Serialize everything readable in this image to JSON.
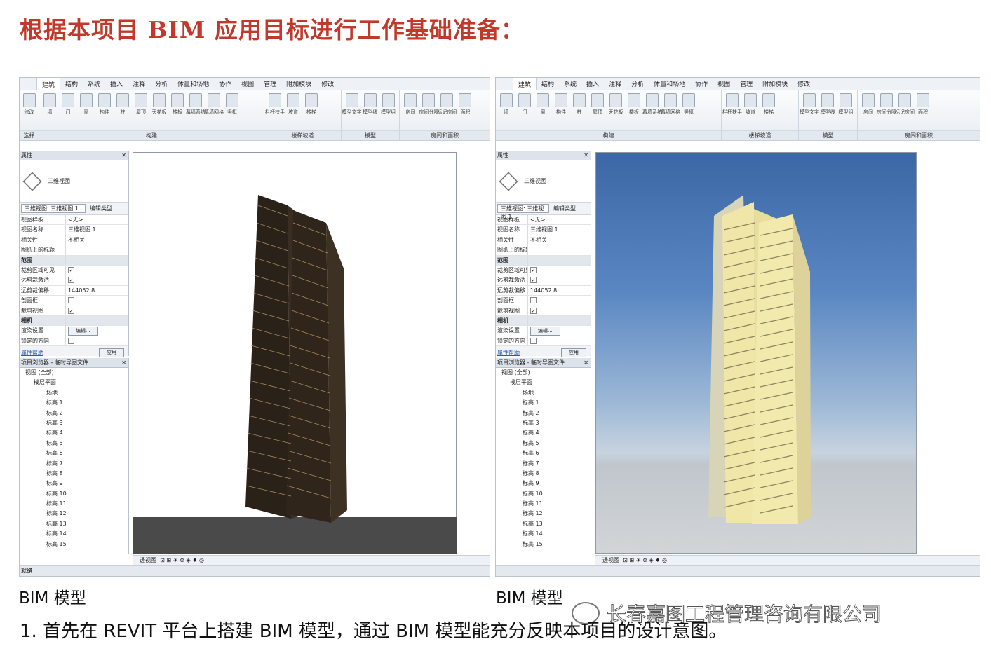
{
  "slide_title": "根据本项目 BIM 应用目标进行工作基础准备：",
  "ribbon": {
    "tabs": [
      "建筑",
      "结构",
      "系统",
      "插入",
      "注释",
      "分析",
      "体量和场地",
      "协作",
      "视图",
      "管理",
      "附加模块",
      "修改"
    ],
    "groups": [
      {
        "label": "构建",
        "buttons": [
          "墙",
          "门",
          "窗",
          "构件",
          "柱",
          "屋顶",
          "天花板",
          "楼板",
          "幕墙系统",
          "幕墙网格",
          "竖梃"
        ]
      },
      {
        "label": "楼梯坡道",
        "buttons": [
          "栏杆扶手",
          "坡道",
          "楼梯"
        ]
      },
      {
        "label": "模型",
        "buttons": [
          "模型文字",
          "模型线",
          "模型组"
        ]
      },
      {
        "label": "房间和面积",
        "buttons": [
          "房间",
          "房间分隔",
          "标记房间",
          "面积"
        ]
      }
    ],
    "modify_label": "修改",
    "select_label": "选择"
  },
  "properties": {
    "header": "属性",
    "type_name": "三维视图",
    "selector": "三维视图: 三维视图 1",
    "edit_type": "编辑类型",
    "rows": [
      {
        "key": "视图样板",
        "value": "<无>"
      },
      {
        "key": "视图名称",
        "value": "三维视图 1"
      },
      {
        "key": "相关性",
        "value": "不相关"
      },
      {
        "key": "图纸上的标题",
        "value": ""
      }
    ],
    "section_extents": "范围",
    "extent_rows": [
      {
        "key": "裁剪区域可见",
        "checked": true
      },
      {
        "key": "远剪裁激活",
        "checked": true
      },
      {
        "key": "远剪裁偏移",
        "value": "144052.8"
      },
      {
        "key": "剖面框",
        "checked": false
      },
      {
        "key": "裁剪视图",
        "checked": true
      }
    ],
    "section_camera": "相机",
    "render_settings": "渲染设置",
    "edit_button": "编辑...",
    "locked_orientation": "锁定的方向",
    "help_link": "属性帮助",
    "apply_button": "应用"
  },
  "browser": {
    "header": "项目浏览器 - 临时导图文件",
    "root": "视图 (全部)",
    "floor_plans": "楼层平面",
    "items": [
      "场地",
      "标高 1",
      "标高 2",
      "标高 3",
      "标高 4",
      "标高 5",
      "标高 6",
      "标高 7",
      "标高 8",
      "标高 9",
      "标高 10",
      "标高 11",
      "标高 12",
      "标高 13",
      "标高 14",
      "标高 15"
    ]
  },
  "view_bar": {
    "label": "透视图",
    "icons": "⊡ ⊞ ☀ ⊛ ◈ ♦ ◎"
  },
  "status_bar": "就绪",
  "captions": {
    "left": "BIM 模型",
    "right": "BIM 模型"
  },
  "watermark": "长春嘉图工程管理咨询有限公司",
  "body_text": "1. 首先在 REVIT 平台上搭建 BIM 模型，通过 BIM 模型能充分反映本项目的设计意图。"
}
